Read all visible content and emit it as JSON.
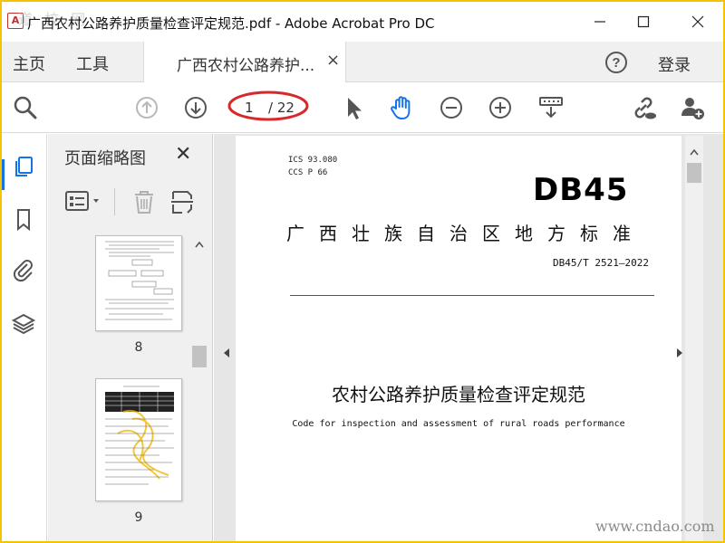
{
  "window": {
    "title": "广西农村公路养护质量检查评定规范.pdf - Adobe Acrobat Pro DC",
    "app_icon_glyph": "A"
  },
  "menu": {
    "home": "主页",
    "tools": "工具",
    "doc_tab_label": "广西农村公路养护...",
    "doc_tab_close": "×",
    "login": "登录"
  },
  "toolbar": {
    "current_page": "1",
    "total_pages": "/ 22"
  },
  "thumbnails_panel": {
    "title": "页面缩略图",
    "close": "✕",
    "pages": [
      {
        "number": "8"
      },
      {
        "number": "9"
      }
    ]
  },
  "document": {
    "ics": "ICS  93.080",
    "ccs": "CCS  P  66",
    "logo": "DB45",
    "standard_name": "广西壮族自治区地方标准",
    "standard_code": "DB45/T  2521—2022",
    "title": "农村公路养护质量检查评定规范",
    "subtitle": "Code for inspection and assessment of rural roads performance"
  },
  "watermarks": {
    "bottom_right": "www.cndao.com",
    "top_left": "道 校 网"
  },
  "colors": {
    "frame": "#f5c400",
    "accent_blue": "#1473e6",
    "icon_gray": "#555555",
    "disabled_gray": "#b8b8b8",
    "annotation_red": "#d9282b"
  }
}
